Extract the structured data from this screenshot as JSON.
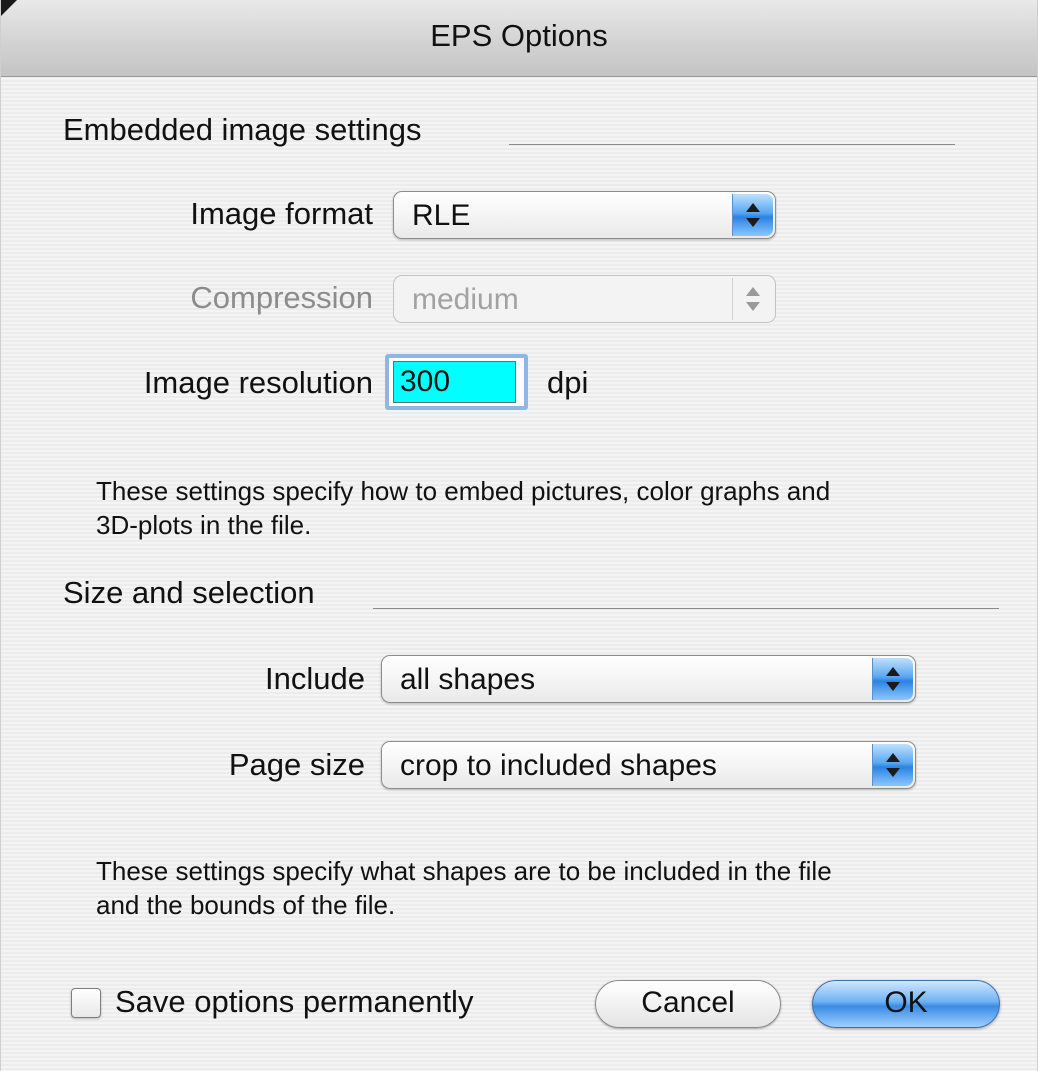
{
  "window": {
    "title": "EPS Options"
  },
  "embedded": {
    "section_title": "Embedded image settings",
    "image_format_label": "Image format",
    "image_format_value": "RLE",
    "compression_label": "Compression",
    "compression_value": "medium",
    "resolution_label": "Image resolution",
    "resolution_value": "300",
    "resolution_unit": "dpi",
    "description_line1": "These settings specify how to embed pictures, color graphs and",
    "description_line2": "3D-plots in the file."
  },
  "size_selection": {
    "section_title": "Size and selection",
    "include_label": "Include",
    "include_value": "all shapes",
    "page_size_label": "Page size",
    "page_size_value": "crop to included shapes",
    "description_line1": "These settings specify what shapes are to be included in the file",
    "description_line2": "and the bounds of the file."
  },
  "footer": {
    "save_options_label": "Save options permanently",
    "save_options_checked": false,
    "cancel_label": "Cancel",
    "ok_label": "OK"
  },
  "colors": {
    "selected_field_bg": "#00ffff",
    "focus_ring": "#8fb7e6",
    "aqua_blue": "#3a8be4"
  },
  "icons": [
    "popup-arrows-icon",
    "checkbox-icon"
  ]
}
